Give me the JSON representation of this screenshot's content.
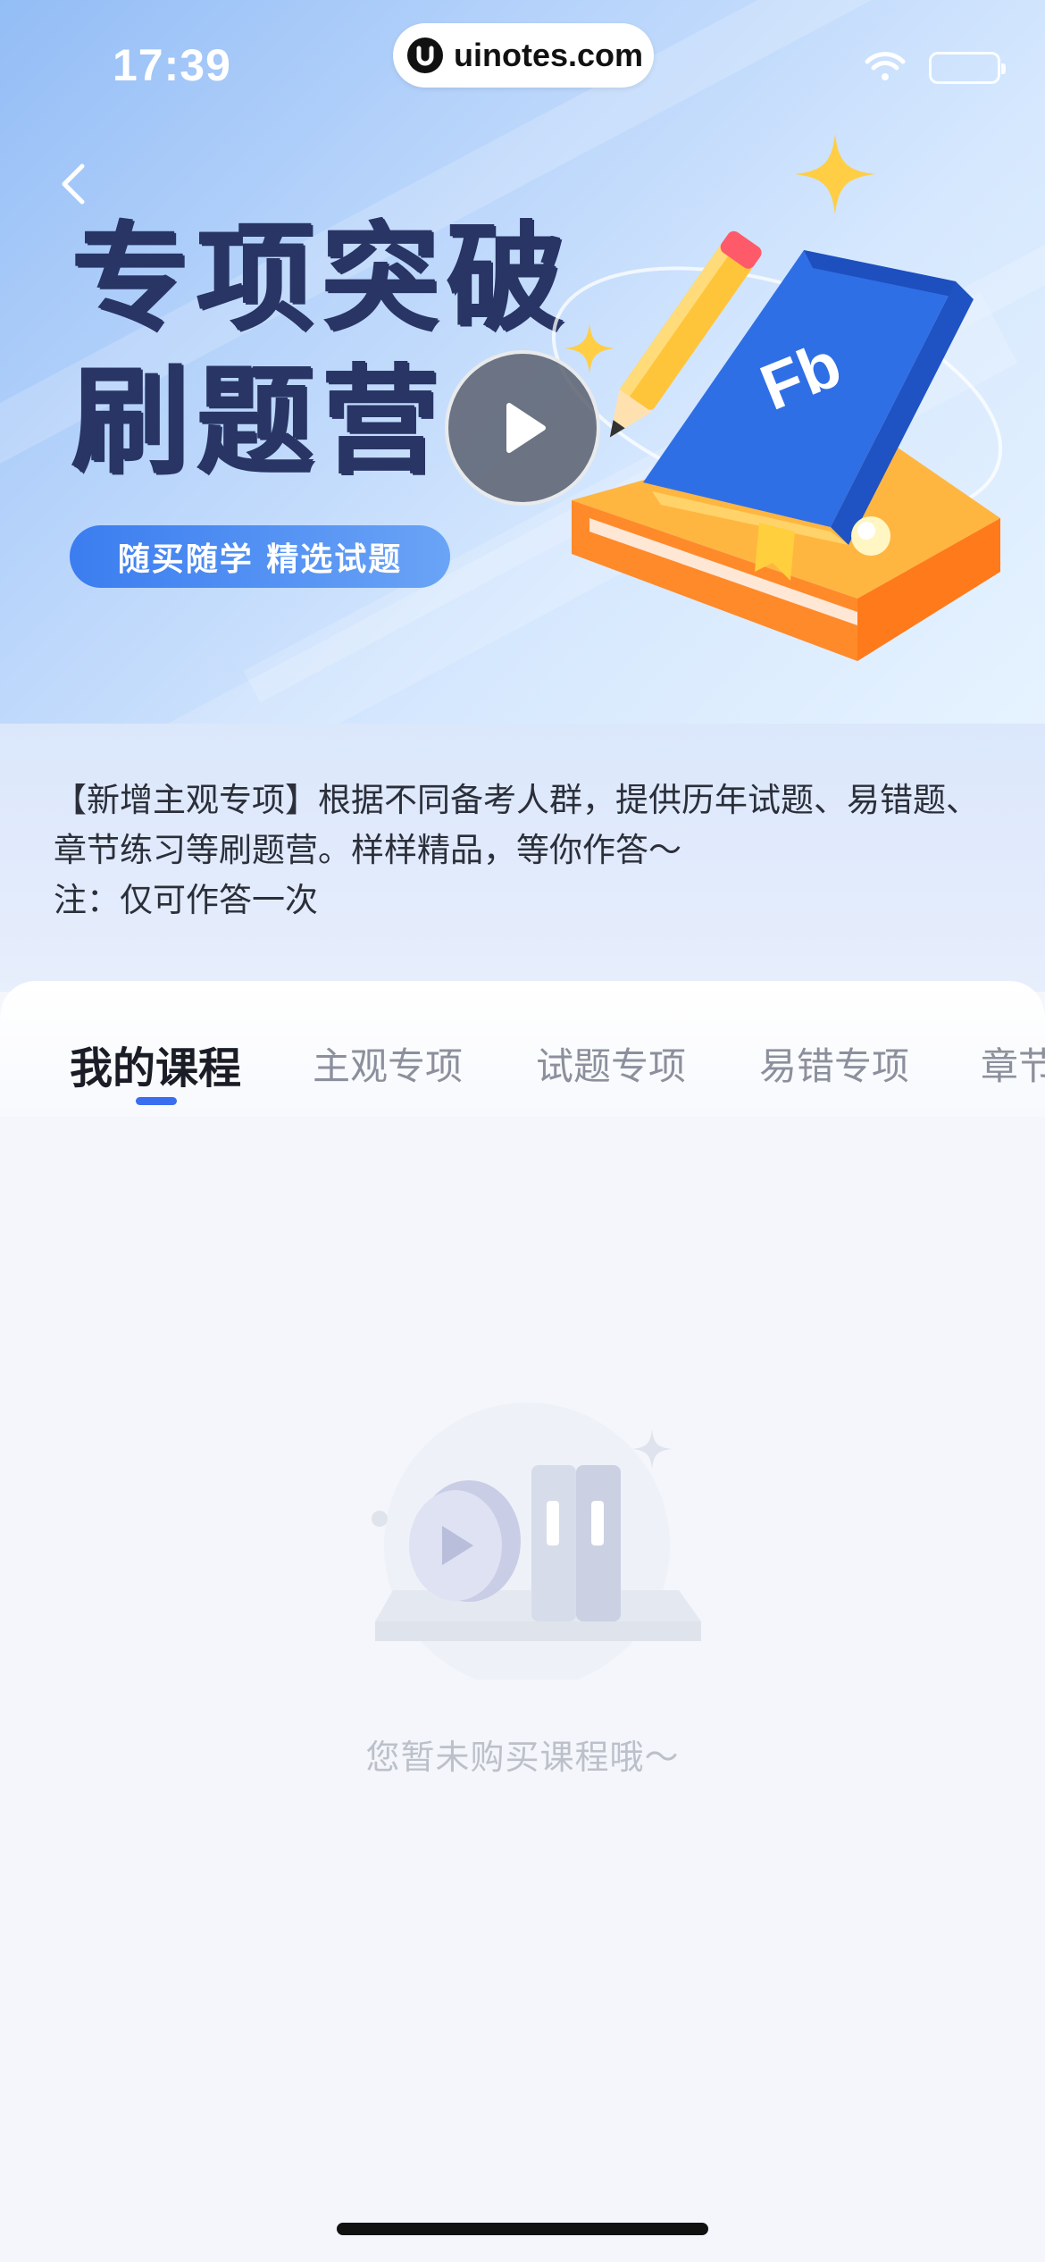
{
  "status_bar": {
    "time": "17:39",
    "watermark": "uinotes.com"
  },
  "banner": {
    "title_line1": "专项突破",
    "title_line2": "刷题营",
    "tag": "随买随学 精选试题",
    "book_logo": "Fb"
  },
  "description": {
    "line1": "【新增主观专项】根据不同备考人群，提供历年试题、易错题、章节练习等刷题营。样样精品，等你作答～",
    "line2": "注：仅可作答一次"
  },
  "tabs": [
    {
      "label": "我的课程",
      "active": true
    },
    {
      "label": "主观专项",
      "active": false
    },
    {
      "label": "试题专项",
      "active": false
    },
    {
      "label": "易错专项",
      "active": false
    },
    {
      "label": "章节",
      "active": false
    }
  ],
  "empty_state": {
    "text": "您暂未购买课程哦～"
  },
  "colors": {
    "accent": "#3b6df0",
    "title": "#283565",
    "tag": "#3b7df0"
  }
}
